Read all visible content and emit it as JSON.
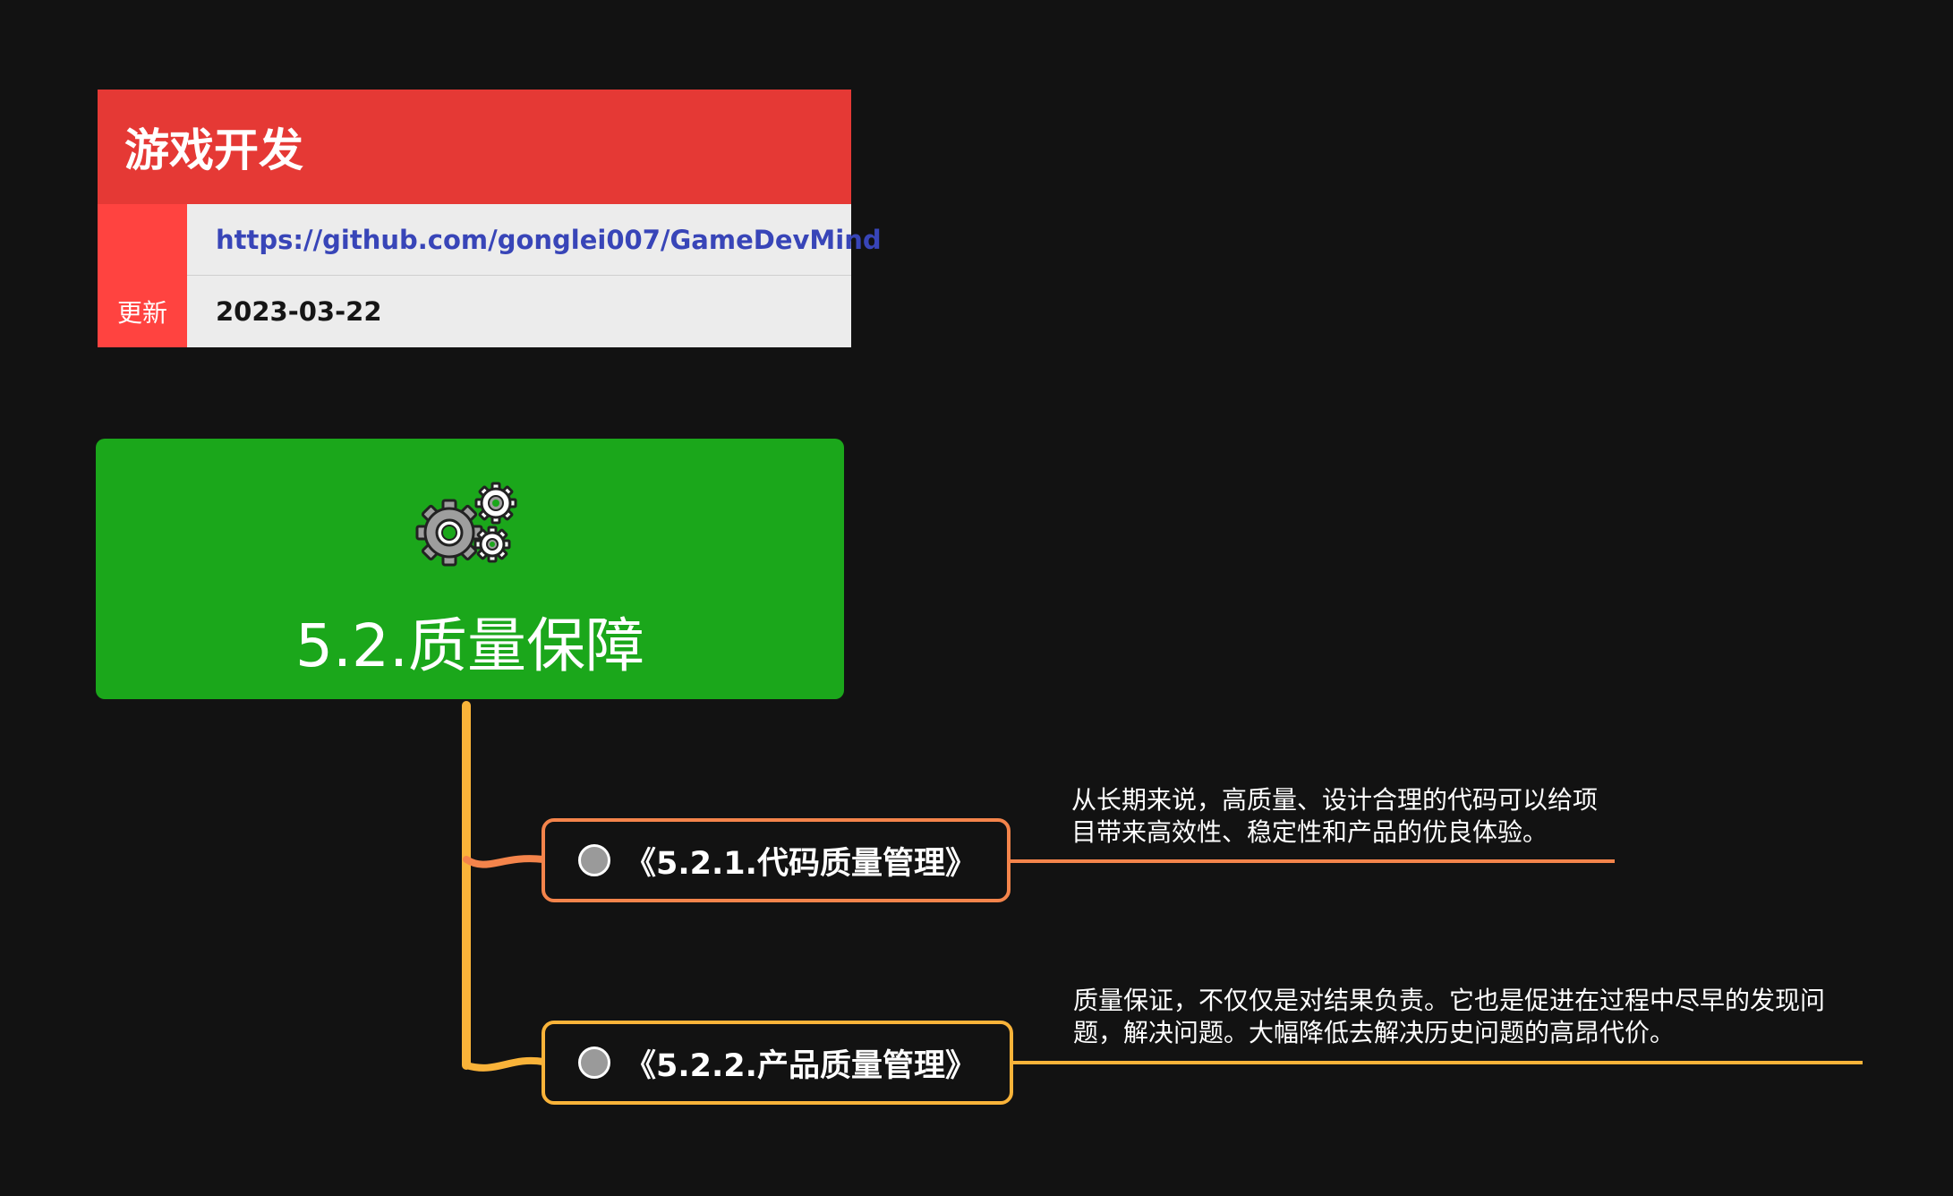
{
  "header": {
    "title": "游戏开发",
    "rows": [
      {
        "key": "",
        "value": "https://github.com/gonglei007/GameDevMind"
      },
      {
        "key": "更新",
        "value": "2023-03-22"
      }
    ]
  },
  "root": {
    "icon": "gears-icon",
    "title": "5.2.质量保障"
  },
  "children": [
    {
      "label": "《5.2.1.代码质量管理》",
      "note_lines": [
        "从长期来说，高质量、设计合理的代码可以给项",
        "目带来高效性、稳定性和产品的优良体验。"
      ],
      "color": "#f4844b"
    },
    {
      "label": "《5.2.2.产品质量管理》",
      "note_lines": [
        "质量保证，不仅仅是对结果负责。它也是促进在过程中尽早的发现问",
        "题，解决问题。大幅降低去解决历史问题的高昂代价。"
      ],
      "color": "#f9b339"
    }
  ],
  "colors": {
    "background": "#121212",
    "header_red": "#e53935",
    "root_green": "#1ba71b",
    "branch_orange": "#f9b339"
  }
}
